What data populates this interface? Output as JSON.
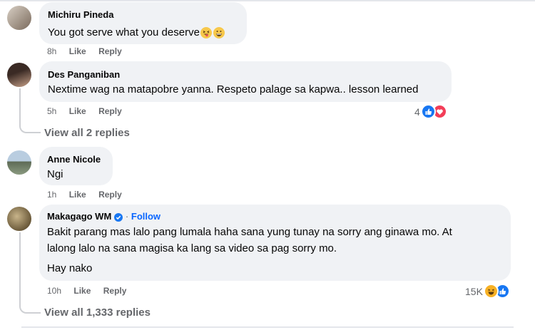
{
  "comments": [
    {
      "name": "Michiru Pineda",
      "text": "You got serve what you deserve",
      "time": "8h",
      "like": "Like",
      "reply": "Reply",
      "emojis": [
        "squinting-tongue-emoji",
        "grinning-emoji"
      ]
    },
    {
      "name": "Des Panganiban",
      "text": "Nextime wag na matapobre yanna. Respeto palage sa kapwa.. lesson learned",
      "time": "5h",
      "like": "Like",
      "reply": "Reply",
      "reaction_count": "4",
      "reactions": [
        "like-reaction-icon",
        "love-reaction-icon"
      ],
      "view_replies": "View all 2 replies"
    },
    {
      "name": "Anne Nicole",
      "text": "Ngi",
      "time": "1h",
      "like": "Like",
      "reply": "Reply"
    },
    {
      "name": "Makagago WM",
      "follow": "Follow",
      "text_line1": "Bakit parang mas lalo pang lumala haha sana yung tunay na sorry ang ginawa mo. At",
      "text_line2": "lalong lalo na sana magisa ka lang sa video sa pag sorry mo.",
      "text_line3": "Hay nako",
      "time": "10h",
      "like": "Like",
      "reply": "Reply",
      "reaction_count": "15K",
      "reactions": [
        "haha-reaction-icon",
        "like-reaction-icon"
      ],
      "view_replies": "View all 1,333 replies"
    }
  ],
  "colors": {
    "bubble": "#f0f2f5",
    "meta": "#65676b",
    "link": "#0866ff",
    "like": "#1877f2",
    "love": "#f33e58",
    "haha": "#f7b125"
  }
}
